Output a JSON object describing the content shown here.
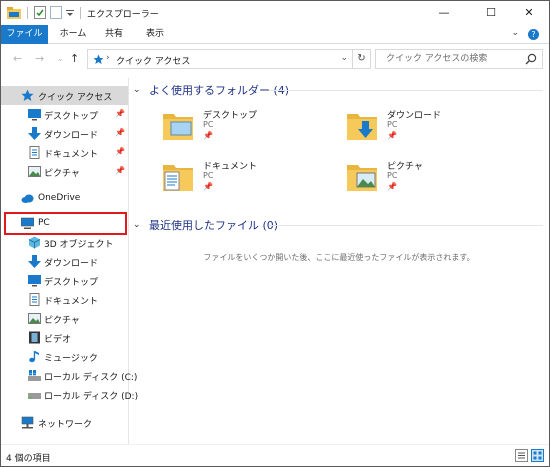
{
  "window": {
    "title": "エクスプローラー",
    "controls": {
      "minimize": "—",
      "maximize": "☐",
      "close": "✕"
    }
  },
  "ribbon": {
    "tabs": [
      "ファイル",
      "ホーム",
      "共有",
      "表示"
    ],
    "help": "?"
  },
  "address": {
    "path": "クイック アクセス",
    "search_placeholder": "クイック アクセスの検索"
  },
  "nav_pane": {
    "quick_access": "クイック アクセス",
    "pinned": [
      "デスクトップ",
      "ダウンロード",
      "ドキュメント",
      "ピクチャ"
    ],
    "onedrive": "OneDrive",
    "pc": "PC",
    "pc_children": [
      "3D オブジェクト",
      "ダウンロード",
      "デスクトップ",
      "ドキュメント",
      "ピクチャ",
      "ビデオ",
      "ミュージック",
      "ローカル ディスク (C:)",
      "ローカル ディスク (D:)"
    ],
    "network": "ネットワーク"
  },
  "content": {
    "frequent_header": "よく使用するフォルダー (4)",
    "folders": [
      {
        "name": "デスクトップ",
        "location": "PC"
      },
      {
        "name": "ダウンロード",
        "location": "PC"
      },
      {
        "name": "ドキュメント",
        "location": "PC"
      },
      {
        "name": "ピクチャ",
        "location": "PC"
      }
    ],
    "recent_header": "最近使用したファイル (0)",
    "recent_empty": "ファイルをいくつか開いた後、ここに最近使ったファイルが表示されます。"
  },
  "status": {
    "item_count": "4 個の項目"
  },
  "colors": {
    "accent": "#1979ca",
    "header_text": "#1e3287",
    "highlight": "#e01a1a",
    "folder": "#f5c95a"
  }
}
